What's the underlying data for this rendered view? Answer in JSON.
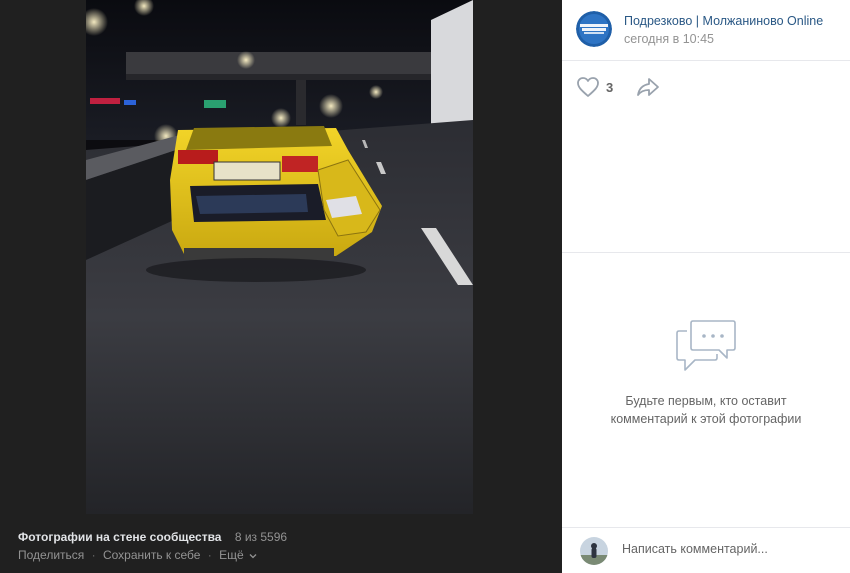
{
  "viewer": {
    "album_title": "Фотографии на стене сообщества",
    "counter": "8 из 5596",
    "actions": {
      "share": "Поделиться",
      "save": "Сохранить к себе",
      "more": "Ещё"
    }
  },
  "post": {
    "author": "Подрезково | Молжаниново Online",
    "time": "сегодня в 10:45",
    "likes": "3"
  },
  "comments": {
    "empty_line1": "Будьте первым, кто оставит",
    "empty_line2": "комментарий к этой фотографии",
    "placeholder": "Написать комментарий..."
  },
  "colors": {
    "link": "#2a5885",
    "muted": "#939393",
    "text": "#656565",
    "viewer_bg": "#202020",
    "panel_bg": "#ffffff",
    "divider": "#e7e8ec",
    "icon_stroke": "#99a2ad",
    "taxi_yellow": "#e8c81a"
  },
  "icons": {
    "like": "heart-outline-icon",
    "share": "share-arrow-icon",
    "empty_comments": "chat-bubble-icon",
    "more": "chevron-down-icon"
  }
}
